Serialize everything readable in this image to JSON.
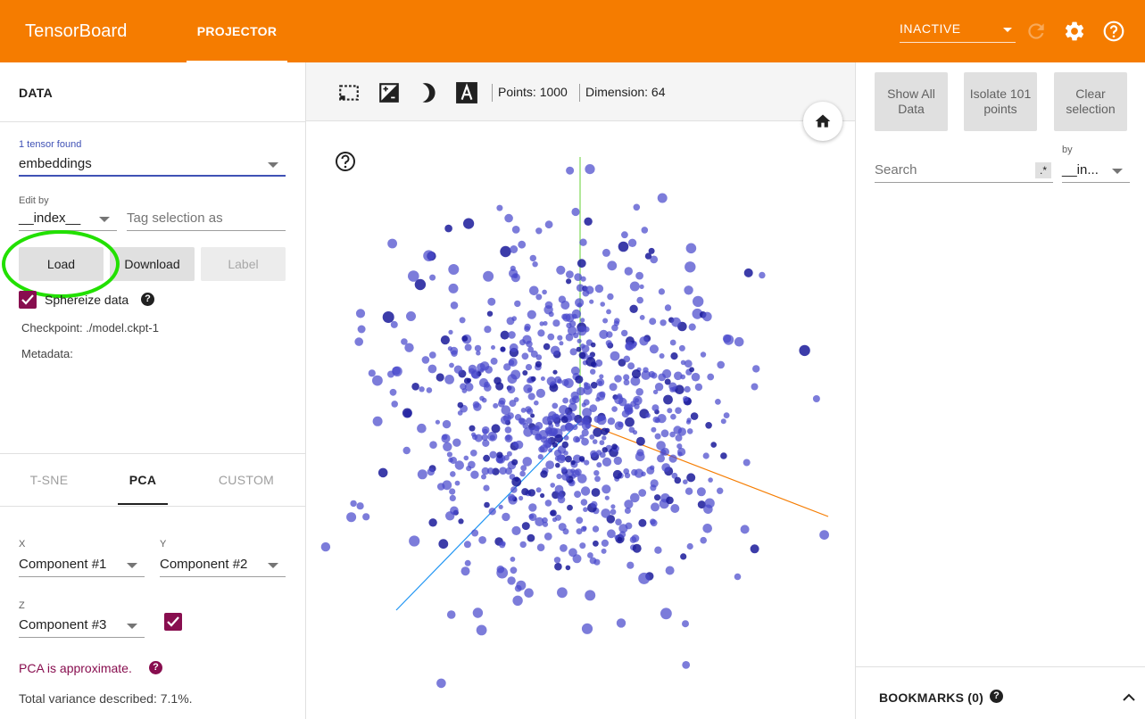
{
  "header": {
    "app_title": "TensorBoard",
    "tab_label": "PROJECTOR",
    "run_selector_value": "INACTIVE",
    "icons": [
      "refresh-icon",
      "settings-icon",
      "help-icon"
    ]
  },
  "data_panel": {
    "title": "DATA",
    "tensor_found_label": "1 tensor found",
    "tensor_value": "embeddings",
    "edit_by_label": "Edit by",
    "edit_by_value": "__index__",
    "tag_placeholder": "Tag selection as",
    "buttons": {
      "load": "Load",
      "download": "Download",
      "label": "Label"
    },
    "sphereize_label": "Sphereize data",
    "sphereize_checked": true,
    "checkpoint_label": "Checkpoint:",
    "checkpoint_value": "./model.ckpt-1",
    "metadata_label": "Metadata:"
  },
  "projection_tabs": {
    "tabs": [
      "T-SNE",
      "PCA",
      "CUSTOM"
    ],
    "active": "PCA"
  },
  "pca": {
    "x_label": "X",
    "x_value": "Component #1",
    "y_label": "Y",
    "y_value": "Component #2",
    "z_label": "Z",
    "z_value": "Component #3",
    "z_enabled": true,
    "approx_note": "PCA is approximate.",
    "variance_text": "Total variance described: 7.1%."
  },
  "toolbar": {
    "icons": [
      "select-rectangle-icon",
      "night-mode-toggle-icon",
      "moon-icon",
      "label-icon"
    ],
    "points_text": "Points: 1000",
    "dimension_text": "Dimension: 64"
  },
  "right_panel": {
    "show_all": "Show All Data",
    "isolate": "Isolate 101 points",
    "clear": "Clear selection",
    "search_placeholder": "Search",
    "regex_label": ".*",
    "by_label": "by",
    "by_value": "__in...",
    "bookmarks_title": "BOOKMARKS (0)"
  },
  "colors": {
    "header": "#f57c00",
    "accent": "#880e4f",
    "point": "#3f3fbf",
    "axis_x": "#f57c00",
    "axis_y": "#7ed957",
    "axis_z": "#2196f3"
  }
}
